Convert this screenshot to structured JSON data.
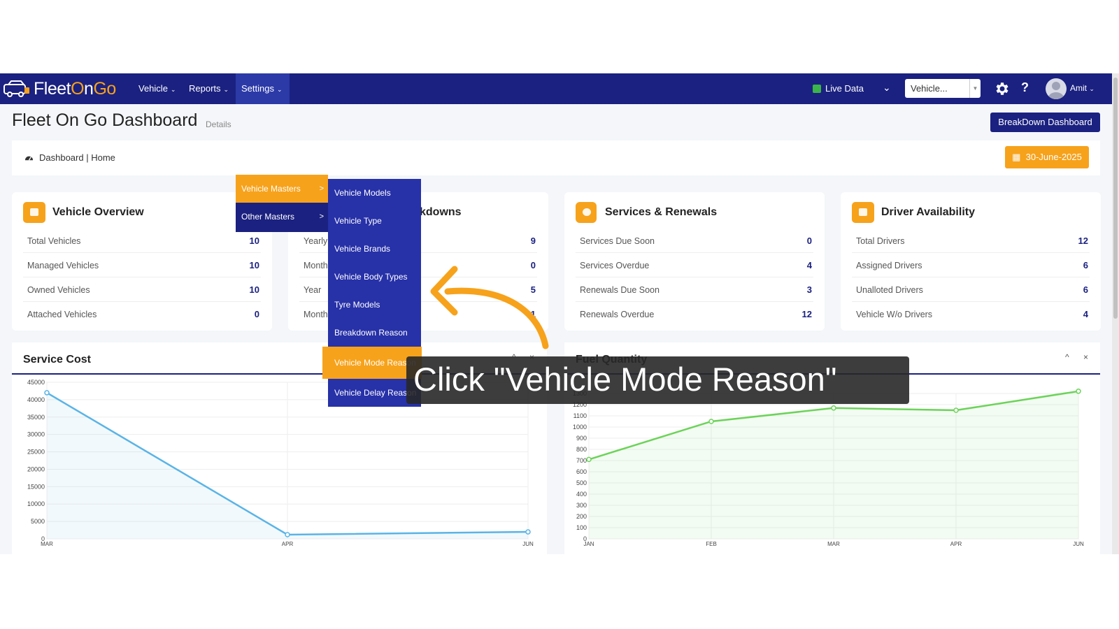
{
  "navbar": {
    "brand_a": "Fleet",
    "brand_o": "O",
    "brand_b": "n",
    "brand_go": "Go",
    "menu": [
      {
        "label": "Vehicle"
      },
      {
        "label": "Reports"
      },
      {
        "label": "Settings"
      }
    ],
    "live_data": "Live Data",
    "vehicle_select": "Vehicle...",
    "help": "?",
    "user": "Amit"
  },
  "header": {
    "title": "Fleet On Go Dashboard",
    "subtitle": "Details",
    "breakdown_button": "BreakDown Dashboard",
    "breadcrumb": "Dashboard | Home",
    "date": "30-June-2025"
  },
  "cards": [
    {
      "title": "Vehicle Overview",
      "rows": [
        {
          "label": "Total Vehicles",
          "value": "10"
        },
        {
          "label": "Managed Vehicles",
          "value": "10"
        },
        {
          "label": "Owned Vehicles",
          "value": "10"
        },
        {
          "label": "Attached Vehicles",
          "value": "0"
        }
      ]
    },
    {
      "title": "kdowns",
      "rows": [
        {
          "label": "Yearly",
          "value": "9"
        },
        {
          "label": "Month",
          "value": "0"
        },
        {
          "label": "Year",
          "value": "5"
        },
        {
          "label": "Month",
          "value": "1"
        }
      ]
    },
    {
      "title": "Services & Renewals",
      "rows": [
        {
          "label": "Services Due Soon",
          "value": "0"
        },
        {
          "label": "Services Overdue",
          "value": "4"
        },
        {
          "label": "Renewals Due Soon",
          "value": "3"
        },
        {
          "label": "Renewals Overdue",
          "value": "12"
        }
      ]
    },
    {
      "title": "Driver Availability",
      "rows": [
        {
          "label": "Total Drivers",
          "value": "12"
        },
        {
          "label": "Assigned Drivers",
          "value": "6"
        },
        {
          "label": "Unalloted Drivers",
          "value": "6"
        },
        {
          "label": "Vehicle W/o Drivers",
          "value": "4"
        }
      ]
    }
  ],
  "panels": {
    "service_cost": {
      "title": "Service Cost"
    },
    "fuel_quantity": {
      "title": "Fuel Quantity"
    },
    "collapse": "^",
    "close": "×"
  },
  "settings_menu": {
    "level1": [
      {
        "label": "Vehicle Masters"
      },
      {
        "label": "Other Masters"
      }
    ],
    "level2": [
      {
        "label": "Vehicle Models"
      },
      {
        "label": "Vehicle Type"
      },
      {
        "label": "Vehicle Brands"
      },
      {
        "label": "Vehicle Body Types"
      },
      {
        "label": "Tyre Models"
      },
      {
        "label": "Breakdown Reason"
      },
      {
        "label": "Vehicle Mode Reason"
      },
      {
        "label": "Vehicle Delay Reason"
      }
    ],
    "submenu_marker": ">"
  },
  "annotation": {
    "text": "Click \"Vehicle Mode Reason\""
  },
  "chart_data": [
    {
      "type": "area",
      "title": "Service Cost",
      "categories": [
        "MAR",
        "APR",
        "JUN"
      ],
      "values": [
        42000,
        1200,
        2000
      ],
      "ylim": [
        0,
        45000
      ],
      "yticks": [
        "0",
        "5000",
        "10000",
        "15000",
        "20000",
        "25000",
        "30000",
        "35000",
        "40000",
        "45000"
      ],
      "color": "#5ab4e6"
    },
    {
      "type": "area",
      "title": "Fuel Quantity",
      "categories": [
        "JAN",
        "FEB",
        "MAR",
        "APR",
        "JUN"
      ],
      "values": [
        710,
        1050,
        1170,
        1150,
        1320
      ],
      "ylim": [
        0,
        1300
      ],
      "yticks": [
        "0",
        "100",
        "200",
        "300",
        "400",
        "500",
        "600",
        "700",
        "800",
        "900",
        "1000",
        "1100",
        "1200",
        "1300"
      ],
      "color": "#6cd35a"
    }
  ],
  "colors": {
    "navy": "#1b2180",
    "orange": "#f7a21b",
    "submenu": "#2731a8"
  }
}
